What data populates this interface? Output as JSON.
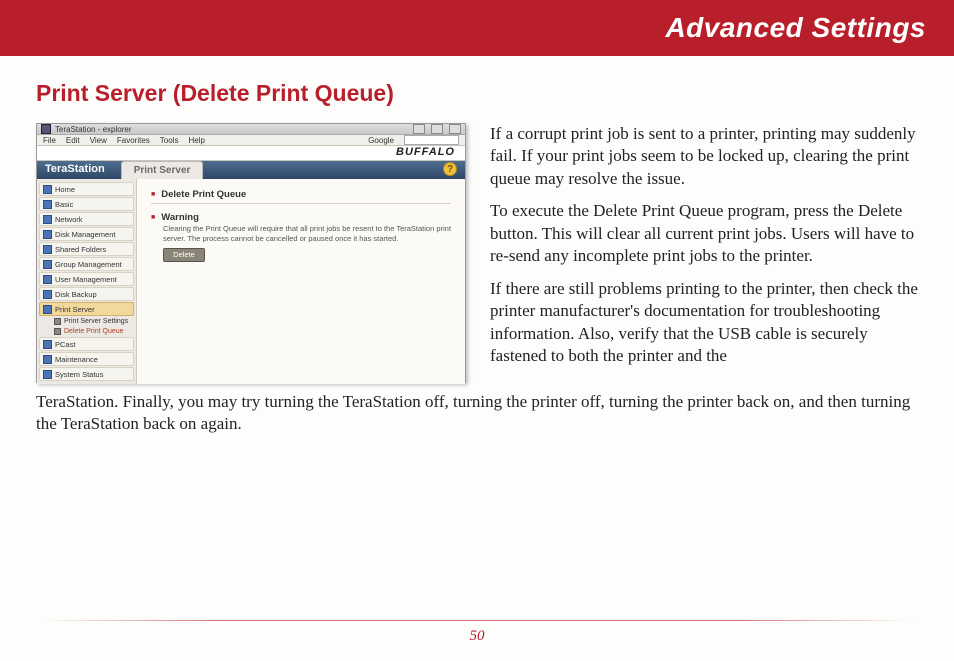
{
  "banner": {
    "title": "Advanced Settings"
  },
  "section": {
    "heading": "Print Server (Delete Print Queue)"
  },
  "screenshot": {
    "window_title": "TeraStation - explorer",
    "menu": [
      "File",
      "Edit",
      "View",
      "Favorites",
      "Tools",
      "Help"
    ],
    "search_label": "Google",
    "brand": "BUFFALO",
    "product": "TeraStation",
    "tab": "Print Server",
    "help_icon": "?",
    "nav": {
      "items": [
        "Home",
        "Basic",
        "Network",
        "Disk Management",
        "Shared Folders",
        "Group Management",
        "User Management",
        "Disk Backup",
        "Print Server",
        "PCast",
        "Maintenance",
        "System Status"
      ],
      "active_index": 8,
      "sub_items": [
        "Print Server Settings",
        "Delete Print Queue"
      ],
      "sub_active_index": 1
    },
    "panel": {
      "heading": "Delete Print Queue",
      "warning_label": "Warning",
      "warning_text": "Clearing the Print Queue will require that all print jobs be resent to the TeraStation print server. The process cannot be cancelled or paused once it has started.",
      "button": "Delete"
    }
  },
  "body": {
    "p1": "If a corrupt print job is sent to a printer, printing may suddenly fail.  If your print jobs seem to be locked up, clearing the print queue may resolve the issue.",
    "p2": "To execute the Delete Print Queue program, press the Delete button.  This will clear all current print jobs.  Users will have to re-send any incomplete print jobs to the printer.",
    "p3a": "If there are still problems printing to the printer, then check the printer manufacturer's documentation for troubleshooting information.  Also, verify that the USB cable is securely fastened to both the printer and the",
    "p3b": "TeraStation.  Finally, you may try turning the TeraStation off, turning the printer off, turning the printer back on, and then turning the TeraStation back on again."
  },
  "page_number": "50"
}
